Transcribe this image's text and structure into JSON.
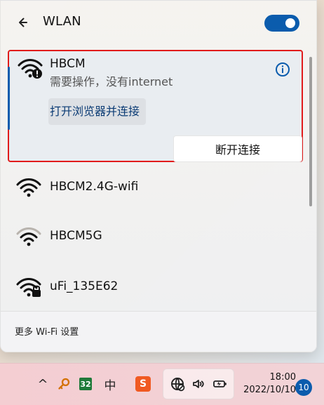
{
  "flyout": {
    "title": "WLAN",
    "toggle": {
      "on": true
    },
    "selected_network": {
      "name": "HBCM",
      "status": "需要操作，没有internet",
      "open_browser_label": "打开浏览器并连接",
      "disconnect_label": "断开连接",
      "icon": "wifi-warning-icon"
    },
    "networks": [
      {
        "name": "HBCM2.4G-wifi",
        "icon": "wifi-icon",
        "locked": false
      },
      {
        "name": "HBCM5G",
        "icon": "wifi-icon",
        "locked": false
      },
      {
        "name": "uFi_135E62",
        "icon": "wifi-lock-icon",
        "locked": true
      }
    ],
    "footer_link": "更多 Wi-Fi 设置"
  },
  "taskbar": {
    "tray": {
      "chevron": "^",
      "badge_32": "32",
      "ime_label": "中",
      "sogou_label": "S"
    },
    "clock": {
      "time": "18:00",
      "date": "2022/10/10"
    },
    "notification_count": "10"
  },
  "colors": {
    "accent": "#0b5cad",
    "highlight_border": "#e11b1b"
  }
}
